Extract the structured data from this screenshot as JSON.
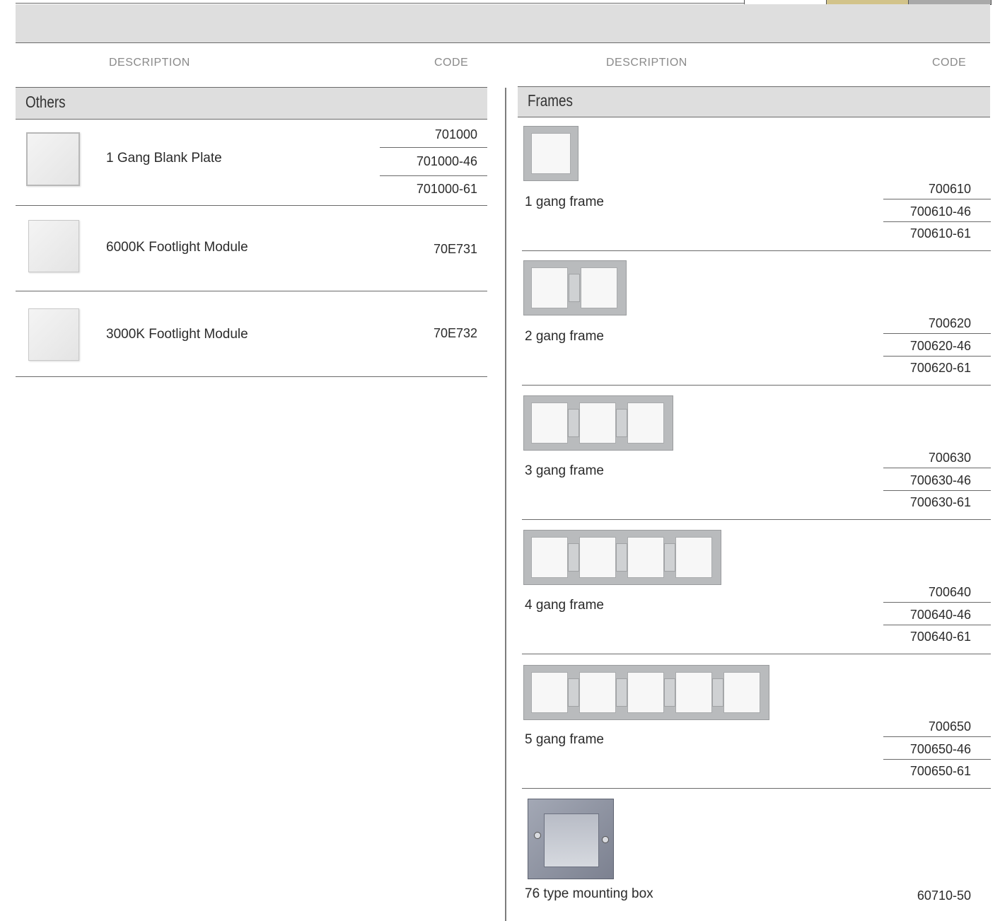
{
  "headers": {
    "left_description": "DESCRIPTION",
    "left_code": "CODE",
    "right_description": "DESCRIPTION",
    "right_code": "CODE"
  },
  "colors": {
    "band_grey": "#dedede",
    "swatch_white": "#ffffff",
    "swatch_gold": "#d2c38a",
    "swatch_grey": "#a9a9a9"
  },
  "others": {
    "title": "Others",
    "items": [
      {
        "description": "1 Gang Blank Plate",
        "codes": [
          "701000",
          "701000-46",
          "701000-61"
        ]
      },
      {
        "description": "6000K Footlight Module",
        "codes": [
          "70E731"
        ]
      },
      {
        "description": "3000K Footlight Module",
        "codes": [
          "70E732"
        ]
      }
    ]
  },
  "frames": {
    "title": "Frames",
    "items": [
      {
        "description": "1 gang frame",
        "codes": [
          "700610",
          "700610-46",
          "700610-61"
        ]
      },
      {
        "description": "2 gang frame",
        "codes": [
          "700620",
          "700620-46",
          "700620-61"
        ]
      },
      {
        "description": "3 gang frame",
        "codes": [
          "700630",
          "700630-46",
          "700630-61"
        ]
      },
      {
        "description": "4 gang frame",
        "codes": [
          "700640",
          "700640-46",
          "700640-61"
        ]
      },
      {
        "description": "5 gang frame",
        "codes": [
          "700650",
          "700650-46",
          "700650-61"
        ]
      },
      {
        "description": "76 type mounting box",
        "codes": [
          "60710-50"
        ]
      }
    ]
  }
}
